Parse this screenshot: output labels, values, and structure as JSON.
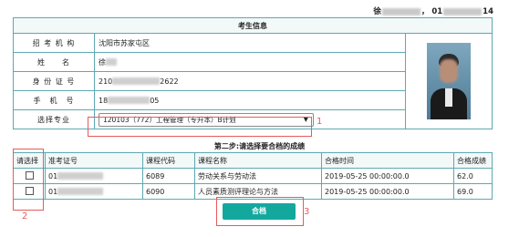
{
  "header": {
    "user_prefix": "徐",
    "user_mid": "， 01",
    "user_suffix": "14"
  },
  "info": {
    "title": "考生信息",
    "rows": [
      {
        "label": "招 考 机 构",
        "value": "沈阳市苏家屯区"
      },
      {
        "label": "姓　　名",
        "value": "徐"
      },
      {
        "label": "身 份 证 号",
        "value_prefix": "210",
        "value_suffix": "2622"
      },
      {
        "label": "手　机　号",
        "value_prefix": "18",
        "value_suffix": "05"
      }
    ],
    "major_label": "选择专业",
    "major_selected": "120103（772）工程管理（专升本）B计划"
  },
  "step2": {
    "title": "第二步:请选择要合档的成绩"
  },
  "scores": {
    "columns": [
      "请选择",
      "准考证号",
      "课程代码",
      "课程名称",
      "合格时间",
      "合格成绩"
    ],
    "rows": [
      {
        "ticket_prefix": "01",
        "course_code": "6089",
        "course_name": "劳动关系与劳动法",
        "pass_time": "2019-05-25 00:00:00.0",
        "score": "62.0"
      },
      {
        "ticket_prefix": "01",
        "course_code": "6090",
        "course_name": "人员素质测评理论与方法",
        "pass_time": "2019-05-25 00:00:00.0",
        "score": "69.0"
      }
    ]
  },
  "submit": {
    "label": "合档"
  },
  "annotations": [
    "1",
    "2",
    "3"
  ],
  "colors": {
    "border": "#5ea8b2",
    "button": "#13a89e",
    "annotation": "#e85a5a"
  }
}
